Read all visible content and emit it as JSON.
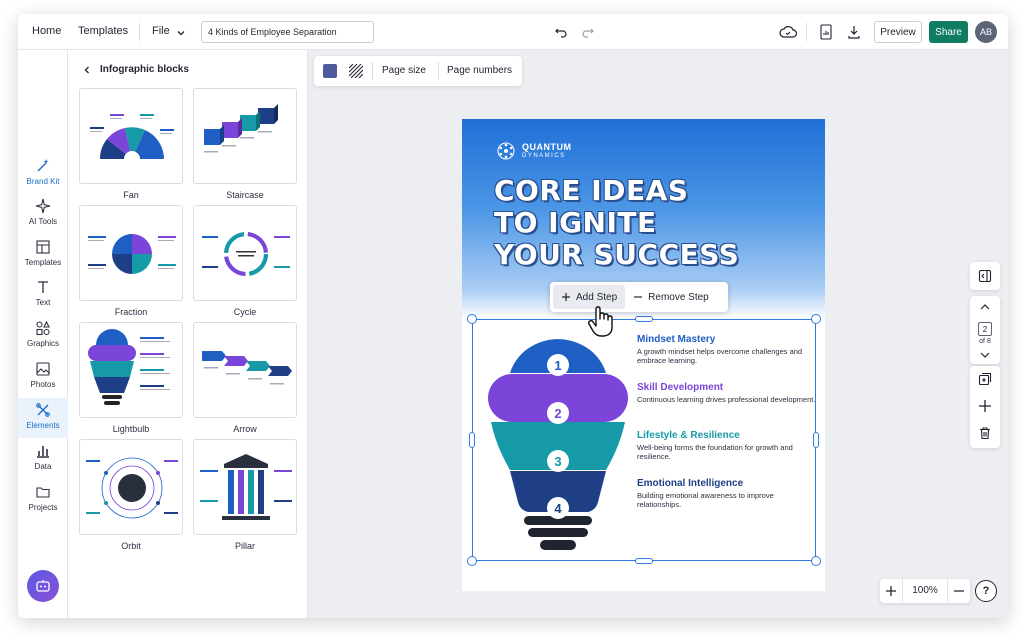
{
  "topbar": {
    "home": "Home",
    "templates": "Templates",
    "file": "File",
    "doc_title": "4 Kinds of Employee Separation",
    "preview": "Preview",
    "share": "Share",
    "avatar": "AB"
  },
  "rail": {
    "items": [
      {
        "label": "Brand Kit"
      },
      {
        "label": "AI Tools"
      },
      {
        "label": "Templates"
      },
      {
        "label": "Text"
      },
      {
        "label": "Graphics"
      },
      {
        "label": "Photos"
      },
      {
        "label": "Elements"
      },
      {
        "label": "Data"
      },
      {
        "label": "Projects"
      }
    ],
    "active": "Elements"
  },
  "panel": {
    "title": "Infographic blocks",
    "blocks": [
      {
        "label": "Fan"
      },
      {
        "label": "Staircase"
      },
      {
        "label": "Fraction"
      },
      {
        "label": "Cycle"
      },
      {
        "label": "Lightbulb"
      },
      {
        "label": "Arrow"
      },
      {
        "label": "Orbit"
      },
      {
        "label": "Pillar"
      }
    ]
  },
  "canvas_toolbar": {
    "page_size": "Page size",
    "page_numbers": "Page numbers",
    "swatch_color": "#4f5a9a"
  },
  "page": {
    "brand_name": "QUANTUM",
    "brand_sub": "DYNAMICS",
    "headline": [
      "CORE IDEAS",
      "TO IGNITE",
      "YOUR SUCCESS"
    ],
    "steps": [
      {
        "num": "1",
        "title": "Mindset Mastery",
        "desc": "A growth mindset helps overcome challenges and embrace learning.",
        "color": "#1f5fc4"
      },
      {
        "num": "2",
        "title": "Skill Development",
        "desc": "Continuous learning drives professional development.",
        "color": "#7a45d8"
      },
      {
        "num": "3",
        "title": "Lifestyle & Resilience",
        "desc": "Well-being forms the foundation for growth and resilience.",
        "color": "#169aa8"
      },
      {
        "num": "4",
        "title": "Emotional Intelligence",
        "desc": "Building emotional awareness to improve relationships.",
        "color": "#1e3f86"
      }
    ]
  },
  "step_popover": {
    "add": "Add Step",
    "remove": "Remove Step"
  },
  "pager": {
    "current": "2",
    "of": "of 8"
  },
  "zoom": {
    "value": "100%"
  }
}
